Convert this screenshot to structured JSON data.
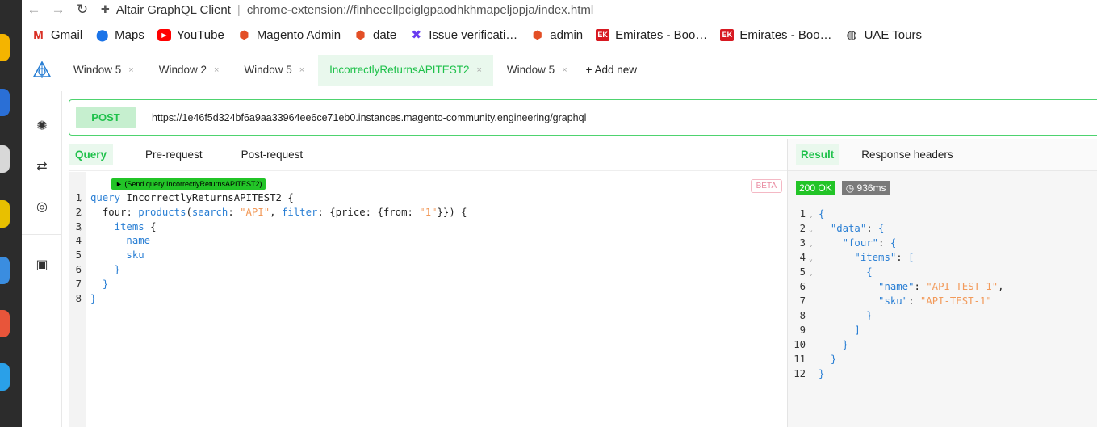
{
  "browser": {
    "tab_title": "Altair GraphQL Client",
    "address": "chrome-extension://flnheeellpciglgpaodhkhmapeljopja/index.html"
  },
  "bookmarks": [
    {
      "label": "Gmail",
      "icon": "gmail-icon"
    },
    {
      "label": "Maps",
      "icon": "maps-icon"
    },
    {
      "label": "YouTube",
      "icon": "youtube-icon"
    },
    {
      "label": "Magento Admin",
      "icon": "magento-icon"
    },
    {
      "label": "date",
      "icon": "magento-icon"
    },
    {
      "label": "Issue verificati…",
      "icon": "jira-icon"
    },
    {
      "label": "admin",
      "icon": "magento-icon"
    },
    {
      "label": "Emirates - Boo…",
      "icon": "ek-icon",
      "icon_text": "EK"
    },
    {
      "label": "Emirates - Boo…",
      "icon": "ek-icon",
      "icon_text": "EK"
    },
    {
      "label": "UAE Tours",
      "icon": "globe-icon"
    }
  ],
  "windows": {
    "tabs": [
      {
        "label": "Window 5",
        "active": false
      },
      {
        "label": "Window 2",
        "active": false
      },
      {
        "label": "Window 5",
        "active": false
      },
      {
        "label": "IncorrectlyReturnsAPITEST2",
        "active": true
      },
      {
        "label": "Window 5",
        "active": false
      }
    ],
    "add_new": "+ Add new",
    "close_glyph": "×"
  },
  "request": {
    "method": "POST",
    "url": "https://1e46f5d324bf6a9aa33964ee6ce71eb0.instances.magento-community.engineering/graphql"
  },
  "query_tabs": [
    "Query",
    "Pre-request",
    "Post-request"
  ],
  "editor": {
    "send_button": "► (Send query IncorrectlyReturnsAPITEST2)",
    "beta_badge": "BETA",
    "line_numbers": [
      "1",
      "2",
      "3",
      "4",
      "5",
      "6",
      "7",
      "8"
    ],
    "query_keyword": "query",
    "operation_name": "IncorrectlyReturnsAPITEST2",
    "alias": "four",
    "field": "products",
    "arg_search": "search",
    "search_value": "\"API\"",
    "arg_filter": "filter",
    "arg_price": "price",
    "arg_from": "from",
    "from_value": "\"1\"",
    "items_field": "items",
    "name_field": "name",
    "sku_field": "sku"
  },
  "result": {
    "tabs": [
      "Result",
      "Response headers"
    ],
    "status": "200 OK",
    "time": "936ms",
    "line_numbers": [
      "1",
      "2",
      "3",
      "4",
      "5",
      "6",
      "7",
      "8",
      "9",
      "10",
      "11",
      "12"
    ],
    "keys": {
      "data": "\"data\"",
      "four": "\"four\"",
      "items": "\"items\"",
      "name": "\"name\"",
      "sku": "\"sku\""
    },
    "values": {
      "name": "\"API-TEST-1\"",
      "sku": "\"API-TEST-1\""
    }
  }
}
